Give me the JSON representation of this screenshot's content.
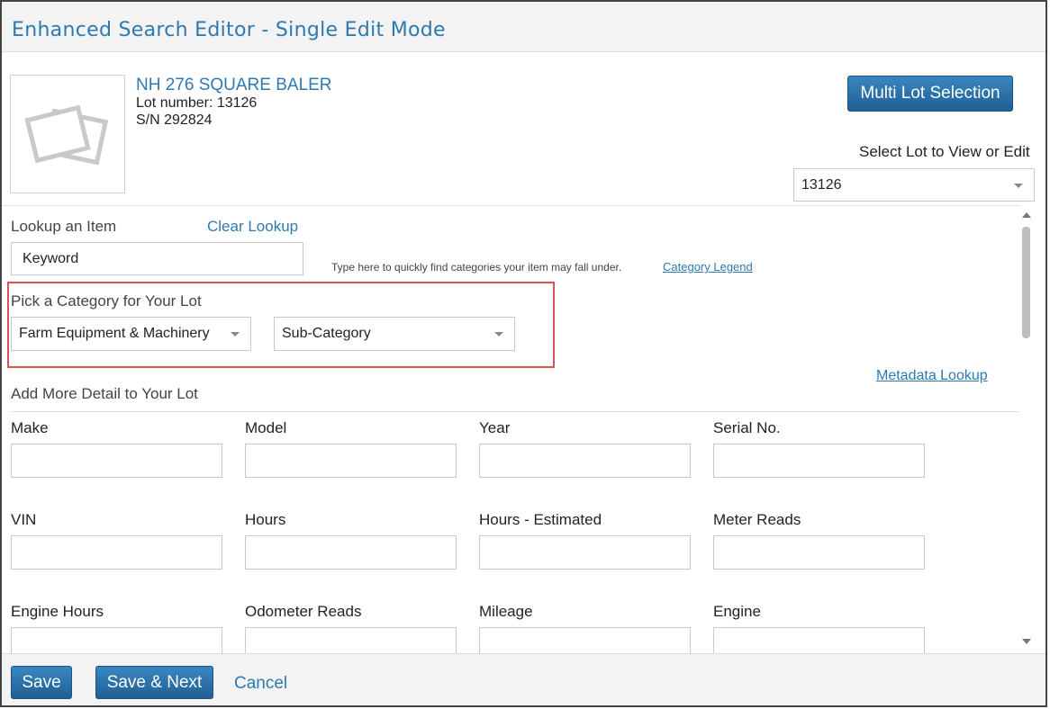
{
  "header": {
    "title": "Enhanced Search Editor - Single Edit Mode"
  },
  "item": {
    "title": "NH 276 SQUARE BALER",
    "lot_line": "Lot number: 13126",
    "sn_line": "S/N 292824"
  },
  "multi_lot_button": "Multi Lot Selection",
  "select_lot": {
    "label": "Select Lot to View or Edit",
    "value": "13126"
  },
  "lookup": {
    "label": "Lookup an Item",
    "clear_label": "Clear Lookup",
    "keyword_value": "Keyword",
    "hint": "Type here to quickly find categories your item may fall under.",
    "legend_link": "Category Legend"
  },
  "category": {
    "label": "Pick a Category for Your Lot",
    "selected": "Farm Equipment & Machinery",
    "sub_selected": "Sub-Category"
  },
  "metadata_link": "Metadata Lookup",
  "detail_label": "Add More Detail to Your Lot",
  "fields": [
    "Make",
    "Model",
    "Year",
    "Serial No.",
    "VIN",
    "Hours",
    "Hours - Estimated",
    "Meter Reads",
    "Engine Hours",
    "Odometer Reads",
    "Mileage",
    "Engine"
  ],
  "footer": {
    "save": "Save",
    "save_next": "Save & Next",
    "cancel": "Cancel"
  },
  "colors": {
    "accent": "#2e79b0",
    "highlight": "#d9534f"
  }
}
